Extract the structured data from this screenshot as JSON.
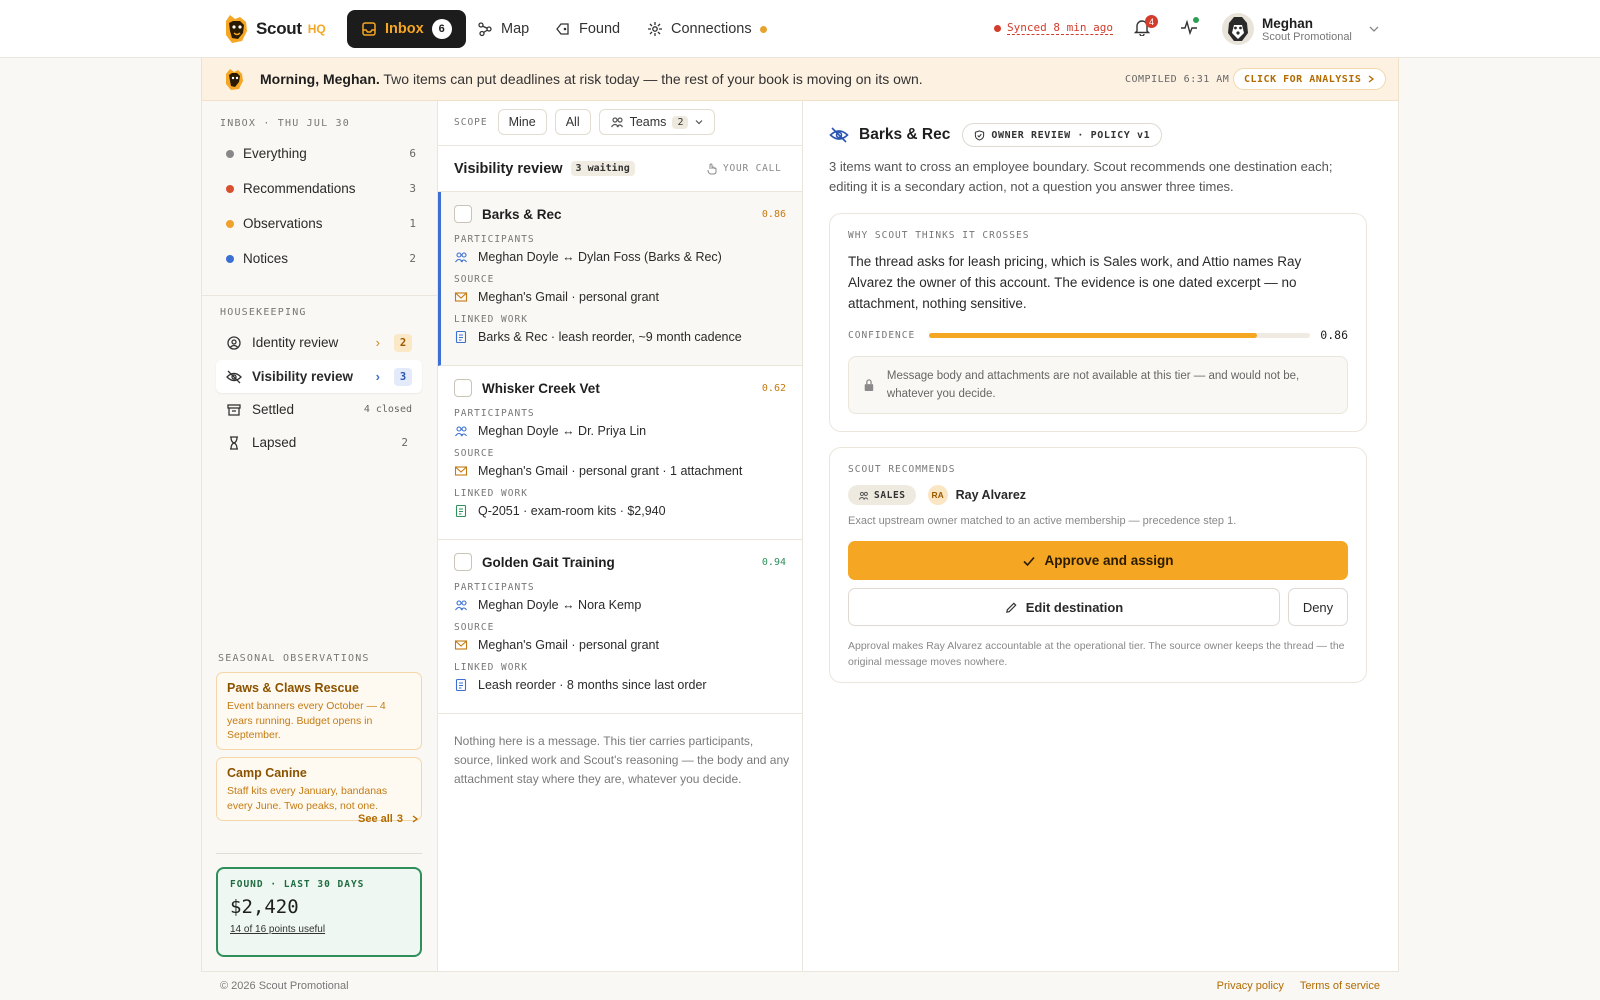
{
  "nav": {
    "brand": "Scout",
    "brand_suffix": "HQ",
    "tabs": [
      {
        "label": "Inbox",
        "count": "6",
        "icon": "inbox-icon",
        "active": true
      },
      {
        "label": "Map",
        "icon": "map-icon"
      },
      {
        "label": "Found",
        "icon": "tag-icon"
      },
      {
        "label": "Connections",
        "icon": "connections-icon",
        "status_dot": true
      }
    ],
    "sync_status": "Synced 8 min ago",
    "notifications_count": "4",
    "user": {
      "name": "Meghan",
      "org": "Scout Promotional"
    }
  },
  "banner": {
    "greeting": "Morning, Meghan.",
    "message": "Two items can put deadlines at risk today — the rest of your book is moving on its own.",
    "compiled": "COMPILED 6:31 AM",
    "analysis_button": "CLICK FOR ANALYSIS"
  },
  "sidebar": {
    "inbox_title": "INBOX · THU JUL 30",
    "inbox_items": [
      {
        "label": "Everything",
        "count": "6",
        "color": "#888888"
      },
      {
        "label": "Recommendations",
        "count": "3",
        "color": "#d9502e"
      },
      {
        "label": "Observations",
        "count": "1",
        "color": "#f0a12b"
      },
      {
        "label": "Notices",
        "count": "2",
        "color": "#3b6fd4"
      }
    ],
    "housekeeping_title": "HOUSEKEEPING",
    "housekeeping": [
      {
        "label": "Identity review",
        "count": "2",
        "icon": "identity-icon"
      },
      {
        "label": "Visibility review",
        "count": "3",
        "icon": "eye-slash-icon"
      },
      {
        "label": "Settled",
        "status": "4 closed",
        "icon": "archive-icon"
      },
      {
        "label": "Lapsed",
        "count": "2",
        "icon": "hourglass-icon"
      }
    ],
    "seasonal_title": "SEASONAL OBSERVATIONS",
    "observations": [
      {
        "title": "Paws & Claws Rescue",
        "body": "Event banners every October — 4 years running. Budget opens in September."
      },
      {
        "title": "Camp Canine",
        "body": "Staff kits every January, bandanas every June. Two peaks, not one."
      }
    ],
    "see_all": "See all",
    "see_all_count": "3",
    "found": {
      "label": "FOUND · LAST 30 DAYS",
      "value": "$2,420",
      "sub": "14 of 16 points useful"
    }
  },
  "scope": {
    "label": "SCOPE",
    "options": [
      "Mine",
      "All"
    ],
    "teams_label": "Teams",
    "teams_count": "2"
  },
  "visibility": {
    "title": "Visibility review",
    "waiting": "3 waiting",
    "your_call": "YOUR CALL",
    "participants_label": "PARTICIPANTS",
    "source_label": "SOURCE",
    "linked_label": "LINKED WORK",
    "items": [
      {
        "name": "Barks & Rec",
        "score": "0.86",
        "score_color": "#c47a12",
        "participants": "Meghan Doyle ↔ Dylan Foss (Barks & Rec)",
        "source": "Meghan's Gmail · personal grant",
        "linked": "Barks & Rec · leash reorder, ~9 month cadence",
        "linked_color": "#3b6fd4"
      },
      {
        "name": "Whisker Creek Vet",
        "score": "0.62",
        "score_color": "#c47a12",
        "participants": "Meghan Doyle ↔ Dr. Priya Lin",
        "source": "Meghan's Gmail · personal grant · 1 attachment",
        "linked": "Q-2051 · exam-room kits · $2,940",
        "linked_color": "#2f8f5b"
      },
      {
        "name": "Golden Gait Training",
        "score": "0.94",
        "score_color": "#2f8f5b",
        "participants": "Meghan Doyle ↔ Nora Kemp",
        "source": "Meghan's Gmail · personal grant",
        "linked": "Leash reorder · 8 months since last order",
        "linked_color": "#3b6fd4"
      }
    ],
    "note": "Nothing here is a message. This tier carries participants, source, linked work and Scout's reasoning — the body and any attachment stay where they are, whatever you decide."
  },
  "detail": {
    "title": "Barks & Rec",
    "policy": "OWNER REVIEW · POLICY v1",
    "description": "3 items want to cross an employee boundary. Scout recommends one destination each; editing it is a secondary action, not a question you answer three times.",
    "why_label": "WHY SCOUT THINKS IT CROSSES",
    "why": "The thread asks for leash pricing, which is Sales work, and Attio names Ray Alvarez the owner of this account. The evidence is one dated excerpt — no attachment, nothing sensitive.",
    "confidence_label": "CONFIDENCE",
    "confidence": 0.86,
    "confidence_text": "0.86",
    "lock_note": "Message body and attachments are not available at this tier — and would not be, whatever you decide.",
    "rec_label": "SCOUT RECOMMENDS",
    "team": "SALES",
    "owner_initials": "RA",
    "owner": "Ray Alvarez",
    "exact": "Exact upstream owner matched to an active membership — precedence step 1.",
    "approve": "Approve and assign",
    "edit": "Edit destination",
    "deny": "Deny",
    "footnote": "Approval makes Ray Alvarez accountable at the operational tier. The source owner keeps the thread — the original message moves nowhere."
  },
  "footer": {
    "copyright": "© 2026 Scout Promotional",
    "links": [
      "Privacy policy",
      "Terms of service"
    ]
  }
}
